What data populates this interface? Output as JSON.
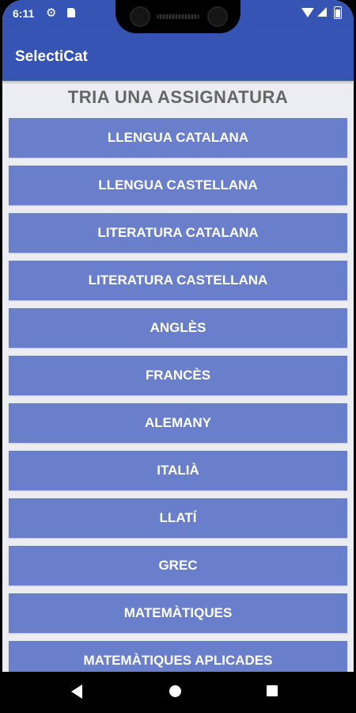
{
  "status_bar": {
    "time": "6:11"
  },
  "app_bar": {
    "title": "SelectiCat"
  },
  "heading": "TRIA UNA ASSIGNATURA",
  "subjects": [
    "LLENGUA CATALANA",
    "LLENGUA CASTELLANA",
    "LITERATURA CATALANA",
    "LITERATURA CASTELLANA",
    "ANGLÈS",
    "FRANCÈS",
    "ALEMANY",
    "ITALIÀ",
    "LLATÍ",
    "GREC",
    "MATEMÀTIQUES",
    "MATEMÀTIQUES APLICADES"
  ],
  "colors": {
    "primary": "#3654b3",
    "button": "#6a7fcb",
    "background": "#ececf3"
  },
  "icons": {
    "status": [
      "gear-icon",
      "sd-card-icon",
      "wifi-icon",
      "signal-icon",
      "battery-icon"
    ],
    "navigation": [
      "back-icon",
      "home-icon",
      "recent-apps-icon"
    ]
  }
}
